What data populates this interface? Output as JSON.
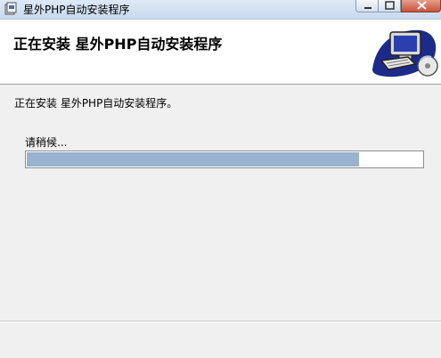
{
  "window": {
    "title": "星外PHP自动安装程序",
    "icon": "installer-icon"
  },
  "header": {
    "title": "正在安装  星外PHP自动安装程序",
    "logo": "computer-install-icon"
  },
  "main": {
    "status": "正在安装 星外PHP自动安装程序。",
    "wait_label": "请稍候...",
    "progress_fraction": 0.84
  },
  "colors": {
    "progress_fill": "#98b2d0",
    "header_bg": "#ffffff",
    "window_bg": "#f0f0f0"
  }
}
